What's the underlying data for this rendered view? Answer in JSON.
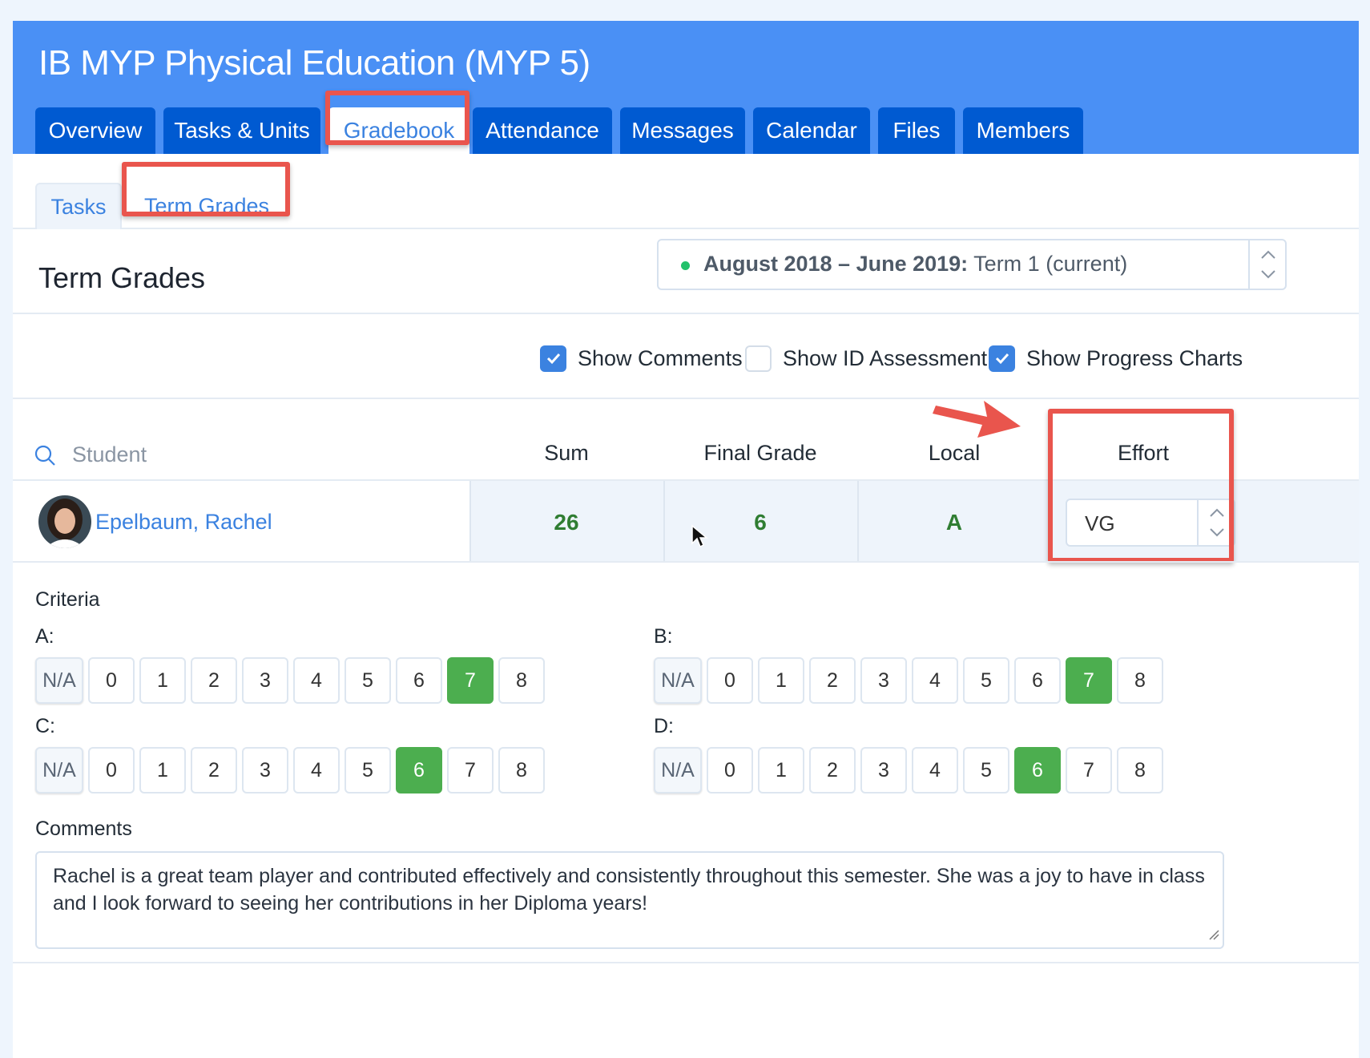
{
  "course": {
    "title": "IB MYP Physical Education (MYP 5)"
  },
  "tabs": [
    {
      "label": "Overview"
    },
    {
      "label": "Tasks & Units"
    },
    {
      "label": "Gradebook"
    },
    {
      "label": "Attendance"
    },
    {
      "label": "Messages"
    },
    {
      "label": "Calendar"
    },
    {
      "label": "Files"
    },
    {
      "label": "Members"
    }
  ],
  "active_tab": "Gradebook",
  "subtabs": [
    {
      "label": "Tasks"
    },
    {
      "label": "Term Grades"
    }
  ],
  "active_subtab": "Term Grades",
  "page": {
    "title": "Term Grades"
  },
  "term_select": {
    "range": "August 2018 – June 2019:",
    "term": "Term 1 (current)",
    "status_color": "#23c16b"
  },
  "options": [
    {
      "label": "Show Comments",
      "checked": true
    },
    {
      "label": "Show ID Assessment",
      "checked": false
    },
    {
      "label": "Show Progress Charts",
      "checked": true
    }
  ],
  "table": {
    "search_placeholder": "Student",
    "columns": {
      "sum": "Sum",
      "final": "Final Grade",
      "local": "Local",
      "effort": "Effort"
    },
    "student": {
      "name": "Epelbaum, Rachel",
      "sum": "26",
      "final": "6",
      "local": "A",
      "effort": "VG"
    }
  },
  "criteria": {
    "heading": "Criteria",
    "scale": [
      "N/A",
      "0",
      "1",
      "2",
      "3",
      "4",
      "5",
      "6",
      "7",
      "8"
    ],
    "items": [
      {
        "label": "A:",
        "selected": "7"
      },
      {
        "label": "B:",
        "selected": "7"
      },
      {
        "label": "C:",
        "selected": "6"
      },
      {
        "label": "D:",
        "selected": "6"
      }
    ]
  },
  "comments": {
    "heading": "Comments",
    "text": "Rachel is a great team player and contributed effectively and consistently throughout this semester. She was a joy to have in class and I look forward to seeing her contributions in her Diploma years!"
  },
  "colors": {
    "header": "#4a90f5",
    "tab": "#005ad1",
    "link": "#3b82e0",
    "selected_grade": "#4cae4f",
    "highlight": "#e9554d"
  }
}
